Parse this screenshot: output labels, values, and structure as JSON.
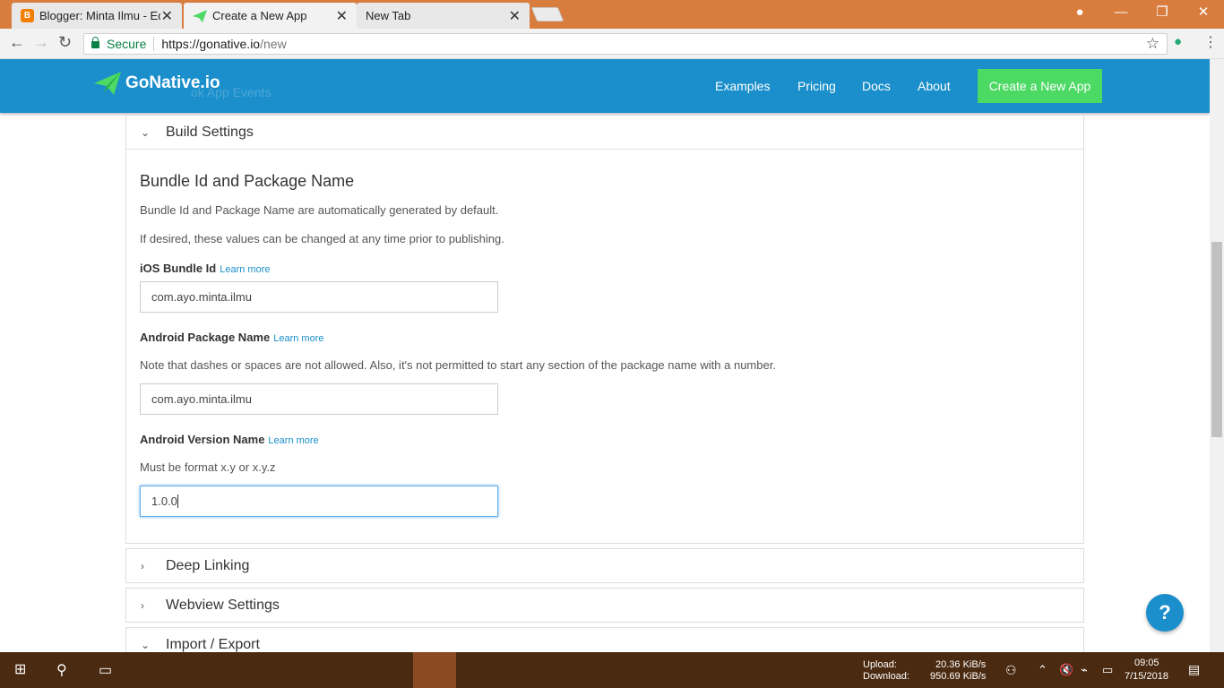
{
  "browser": {
    "tabs": [
      {
        "label": "Blogger: Minta Ilmu - Edit",
        "icon": "blogger-icon"
      },
      {
        "label": "Create a New App",
        "icon": "gonative-icon"
      },
      {
        "label": "New Tab",
        "icon": ""
      }
    ],
    "secure_label": "Secure",
    "url_host": "https://gonative.io",
    "url_path": "/new"
  },
  "header": {
    "logo": "GoNative.io",
    "nav": [
      "Examples",
      "Pricing",
      "Docs",
      "About"
    ],
    "cta": "Create a New App",
    "ghost_text": "ok App Events"
  },
  "build": {
    "title": "Build Settings",
    "section_title": "Bundle Id and Package Name",
    "desc1": "Bundle Id and Package Name are automatically generated by default.",
    "desc2": "If desired, these values can be changed at any time prior to publishing.",
    "learn_more": "Learn more",
    "ios_label": "iOS Bundle Id",
    "ios_value": "com.ayo.minta.ilmu",
    "android_pkg_label": "Android Package Name",
    "android_pkg_note": "Note that dashes or spaces are not allowed. Also, it's not permitted to start any section of the package name with a number.",
    "android_pkg_value": "com.ayo.minta.ilmu",
    "android_ver_label": "Android Version Name",
    "android_ver_note": "Must be format x.y or x.y.z",
    "android_ver_value": "1.0.0"
  },
  "panels": [
    "Deep Linking",
    "Webview Settings",
    "Import / Export"
  ],
  "help": "?",
  "taskbar": {
    "upload_label": "Upload:",
    "upload_value": "20.36 KiB/s",
    "download_label": "Download:",
    "download_value": "950.69 KiB/s",
    "time": "09:05",
    "date": "7/15/2018"
  }
}
